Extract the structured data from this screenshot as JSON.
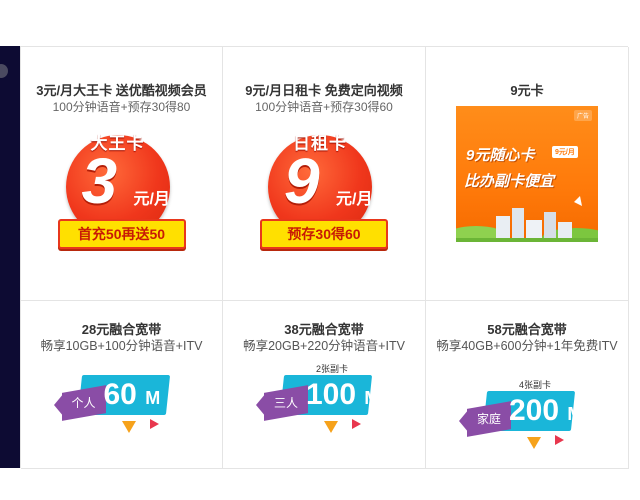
{
  "plans": [
    {
      "title": "3元/月大王卡 送优酷视频会员",
      "sub": "100分钟语音+预存30得80",
      "badge_name": "大王卡",
      "badge_big": "3",
      "badge_unit": "元/月",
      "badge_banner": "首充50再送50"
    },
    {
      "title": "9元/月日租卡 免费定向视频",
      "sub": "100分钟语音+预存30得60",
      "badge_name": "日租卡",
      "badge_big": "9",
      "badge_unit": "元/月",
      "badge_banner": "预存30得60"
    },
    {
      "title": "9元卡",
      "poster_tag": "广告",
      "poster_line1": "9元随心卡",
      "poster_price": "9元/月",
      "poster_line2": "比办副卡便宜"
    }
  ],
  "broadband": [
    {
      "title": "28元融合宽带",
      "sub": "畅享10GB+100分钟语音+ITV",
      "who": "个人",
      "speed": "60",
      "unit": "M",
      "note": ""
    },
    {
      "title": "38元融合宽带",
      "sub": "畅享20GB+220分钟语音+ITV",
      "who": "三人",
      "speed": "100",
      "unit": "M",
      "note": "2张副卡"
    },
    {
      "title": "58元融合宽带",
      "sub": "畅享40GB+600分钟+1年免费ITV",
      "who": "家庭",
      "speed": "200",
      "unit": "M",
      "note": "4张副卡"
    }
  ],
  "colors": {
    "accent_red": "#f0371c",
    "banner_yellow": "#ffe000",
    "broadband_blue": "#1ab6d9",
    "ribbon_purple": "#8a4da6",
    "poster_orange": "#ff7a0a",
    "sidebar_dark": "#0d0b33"
  }
}
